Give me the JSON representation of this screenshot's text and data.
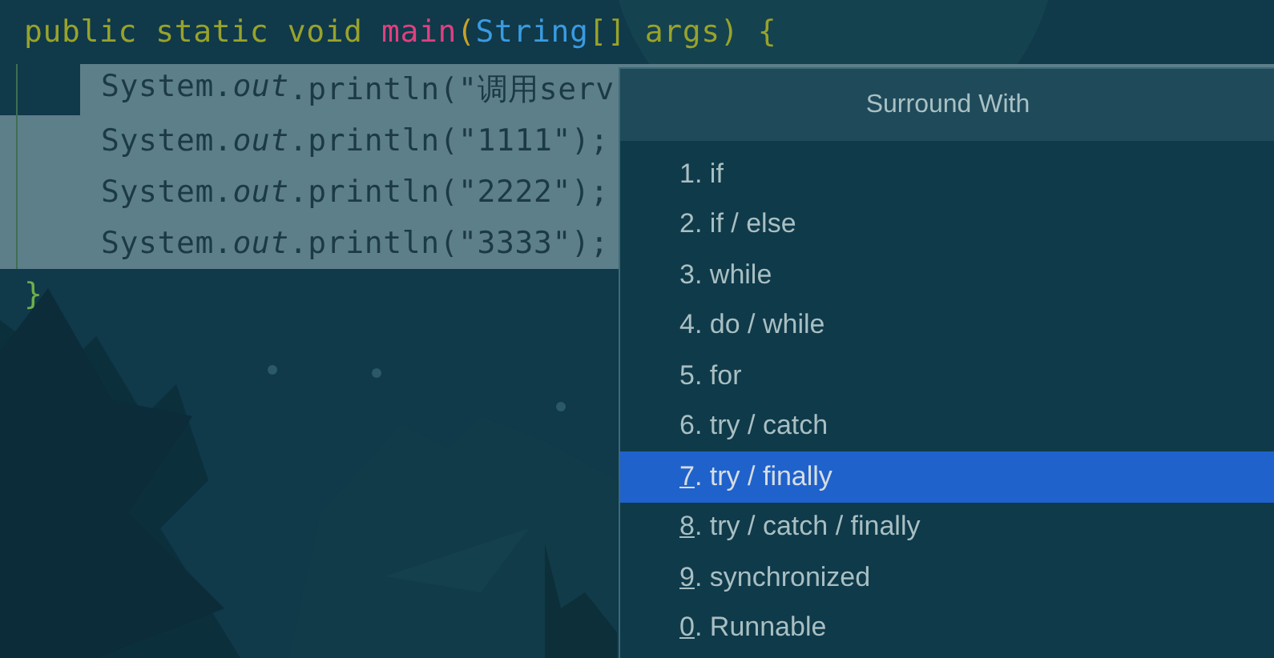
{
  "editor": {
    "signature": [
      {
        "text": "public static void ",
        "kind": "keyword"
      },
      {
        "text": "main",
        "kind": "method"
      },
      {
        "text": "(",
        "kind": "paren"
      },
      {
        "text": "String",
        "kind": "type"
      },
      {
        "text": "[] args) {",
        "kind": "paren_keyword"
      }
    ],
    "body": [
      {
        "selected": true,
        "whole_line": false,
        "tokens": [
          {
            "text": "System.",
            "kind": "plain"
          },
          {
            "text": "out",
            "kind": "field"
          },
          {
            "text": ".println(\"调用serv",
            "kind": "plain"
          }
        ]
      },
      {
        "selected": true,
        "whole_line": true,
        "tokens": [
          {
            "text": "System.",
            "kind": "plain"
          },
          {
            "text": "out",
            "kind": "field"
          },
          {
            "text": ".println(\"1111\");",
            "kind": "plain"
          }
        ]
      },
      {
        "selected": true,
        "whole_line": true,
        "tokens": [
          {
            "text": "System.",
            "kind": "plain"
          },
          {
            "text": "out",
            "kind": "field"
          },
          {
            "text": ".println(\"2222\");",
            "kind": "plain"
          }
        ]
      },
      {
        "selected": true,
        "whole_line": true,
        "tokens": [
          {
            "text": "System.",
            "kind": "plain"
          },
          {
            "text": "out",
            "kind": "field"
          },
          {
            "text": ".println(\"3333\");",
            "kind": "plain"
          }
        ]
      }
    ],
    "closing": [
      {
        "text": "}",
        "kind": "brace"
      }
    ]
  },
  "popup": {
    "title": "Surround With",
    "items": [
      {
        "key": "1",
        "label": ". if",
        "underlined": false,
        "selected": false
      },
      {
        "key": "2",
        "label": ". if / else",
        "underlined": false,
        "selected": false
      },
      {
        "key": "3",
        "label": ". while",
        "underlined": false,
        "selected": false
      },
      {
        "key": "4",
        "label": ". do / while",
        "underlined": false,
        "selected": false
      },
      {
        "key": "5",
        "label": ". for",
        "underlined": false,
        "selected": false
      },
      {
        "key": "6",
        "label": ". try / catch",
        "underlined": false,
        "selected": false
      },
      {
        "key": "7",
        "label": ". try / finally",
        "underlined": true,
        "selected": true
      },
      {
        "key": "8",
        "label": ". try / catch / finally",
        "underlined": true,
        "selected": false
      },
      {
        "key": "9",
        "label": ". synchronized",
        "underlined": true,
        "selected": false
      },
      {
        "key": "0",
        "label": ". Runnable",
        "underlined": true,
        "selected": false
      }
    ]
  }
}
